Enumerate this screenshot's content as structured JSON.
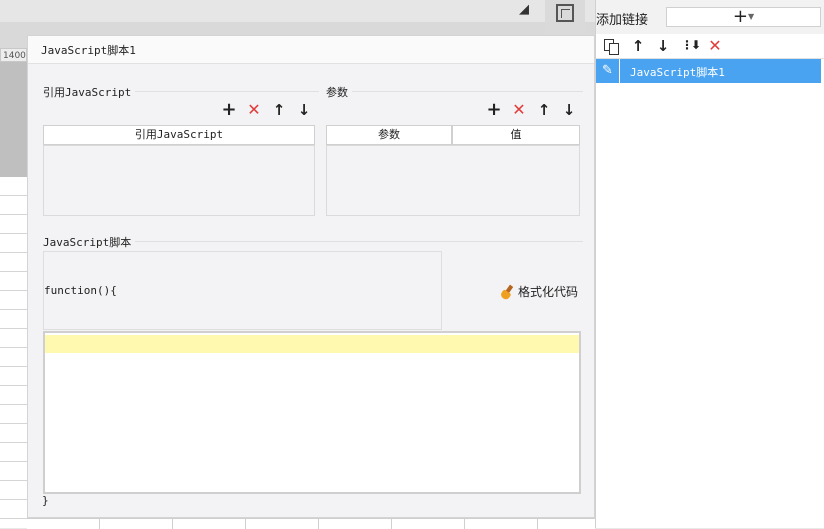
{
  "ruler": {
    "label": "1400"
  },
  "dialog": {
    "title": "JavaScript脚本1",
    "import_section": {
      "label": "引用JavaScript",
      "column_header": "引用JavaScript"
    },
    "params_section": {
      "label": "参数",
      "columns": [
        "参数",
        "值"
      ]
    },
    "toolbar_glyphs": {
      "add": "+",
      "delete": "✕",
      "up": "↑",
      "down": "↓"
    },
    "script_section": {
      "label": "JavaScript脚本",
      "function_header": "function(){",
      "format_button": "格式化代码",
      "closing_brace": "}"
    }
  },
  "right_panel": {
    "add_link_label": "添加链接",
    "add_button_glyph": "+",
    "toolbar_glyphs": {
      "up": "↑",
      "down": "↓",
      "delete": "✕"
    },
    "items": [
      {
        "label": "JavaScript脚本1",
        "selected": true
      }
    ]
  },
  "colors": {
    "selection": "#4aa3f0",
    "delete_red": "#e23b3b",
    "editor_highlight": "#fff9b0"
  }
}
